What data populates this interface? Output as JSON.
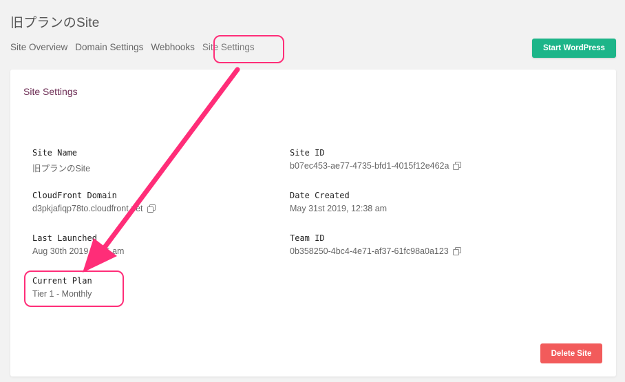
{
  "page": {
    "title": "旧プランのSite"
  },
  "tabs": [
    {
      "label": "Site Overview"
    },
    {
      "label": "Domain Settings"
    },
    {
      "label": "Webhooks"
    },
    {
      "label": "Site Settings"
    }
  ],
  "header": {
    "start_button_label": "Start WordPress"
  },
  "card": {
    "title": "Site Settings",
    "fields": {
      "site_name": {
        "label": "Site Name",
        "value": "旧プランのSite"
      },
      "site_id": {
        "label": "Site ID",
        "value": "b07ec453-ae77-4735-bfd1-4015f12e462a"
      },
      "cloudfront_domain": {
        "label": "CloudFront Domain",
        "value": "d3pkjafiqp78to.cloudfront.net"
      },
      "date_created": {
        "label": "Date Created",
        "value": "May 31st 2019, 12:38 am"
      },
      "last_launched": {
        "label": "Last Launched",
        "value": "Aug 30th 2019, 1:45 am"
      },
      "team_id": {
        "label": "Team ID",
        "value": "0b358250-4bc4-4e71-af37-61fc98a0a123"
      },
      "current_plan": {
        "label": "Current Plan",
        "value": "Tier 1 - Monthly"
      }
    },
    "delete_button_label": "Delete Site"
  },
  "icons": {
    "copy": "copy-icon"
  },
  "colors": {
    "primary": "#1db589",
    "danger": "#f25b5b",
    "annotation": "#ff2d78",
    "card_title": "#6b2a52"
  }
}
